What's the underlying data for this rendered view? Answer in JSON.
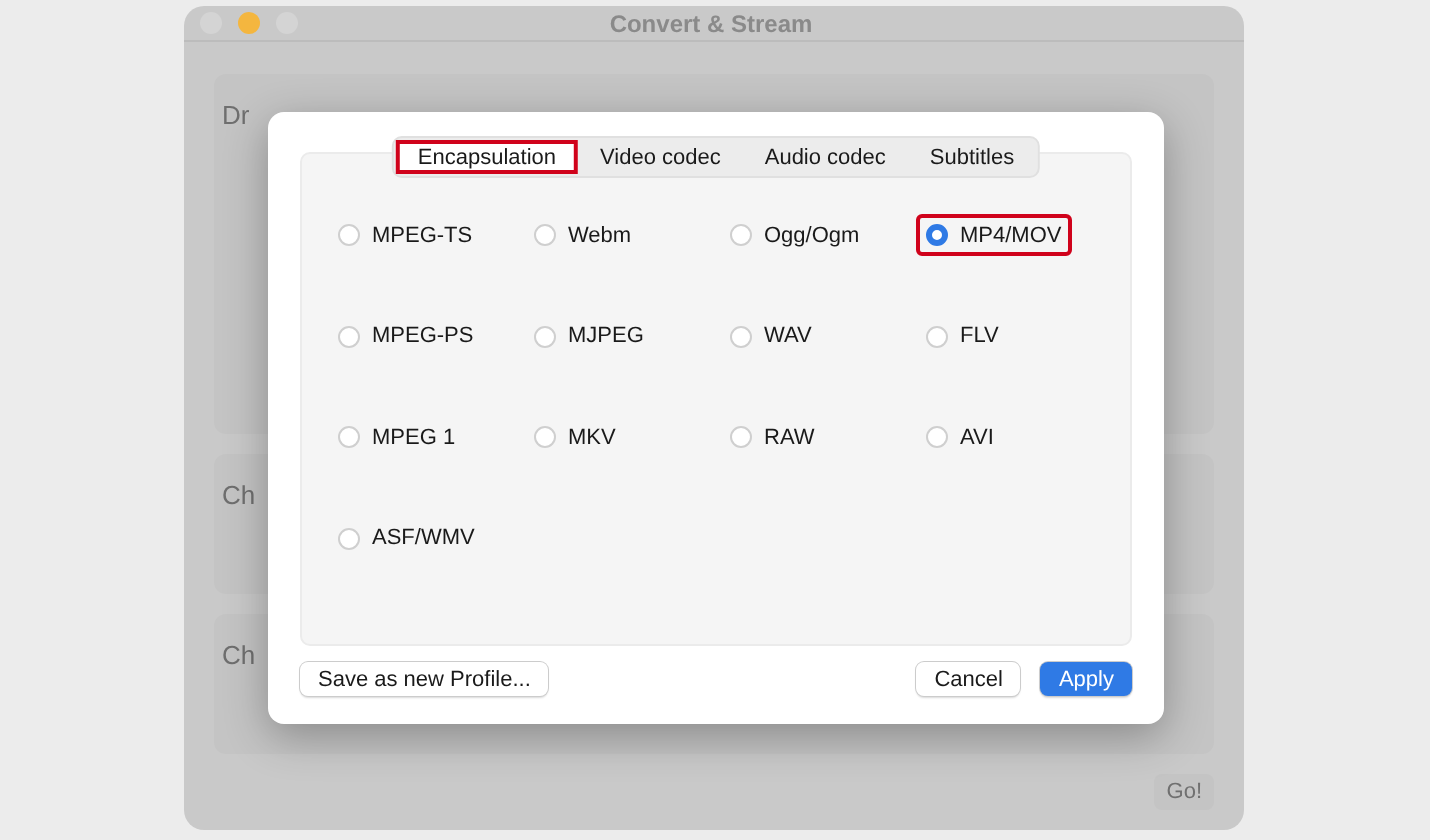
{
  "window": {
    "title": "Convert & Stream",
    "controls": [
      {
        "color": "#d4d4d4"
      },
      {
        "color": "#f4b63f"
      },
      {
        "color": "#d4d4d4"
      }
    ]
  },
  "background": {
    "sections": [
      {
        "heading": "Dr"
      },
      {
        "heading": "Ch"
      },
      {
        "heading": "Ch"
      }
    ],
    "go_button": "Go!"
  },
  "dialog": {
    "tabs": [
      {
        "label": "Encapsulation",
        "selected": true,
        "highlighted": true
      },
      {
        "label": "Video codec",
        "selected": false,
        "highlighted": false
      },
      {
        "label": "Audio codec",
        "selected": false,
        "highlighted": false
      },
      {
        "label": "Subtitles",
        "selected": false,
        "highlighted": false
      }
    ],
    "options": [
      {
        "label": "MPEG-TS",
        "selected": false,
        "highlighted": false
      },
      {
        "label": "Webm",
        "selected": false,
        "highlighted": false
      },
      {
        "label": "Ogg/Ogm",
        "selected": false,
        "highlighted": false
      },
      {
        "label": "MP4/MOV",
        "selected": true,
        "highlighted": true
      },
      {
        "label": "MPEG-PS",
        "selected": false,
        "highlighted": false
      },
      {
        "label": "MJPEG",
        "selected": false,
        "highlighted": false
      },
      {
        "label": "WAV",
        "selected": false,
        "highlighted": false
      },
      {
        "label": "FLV",
        "selected": false,
        "highlighted": false
      },
      {
        "label": "MPEG 1",
        "selected": false,
        "highlighted": false
      },
      {
        "label": "MKV",
        "selected": false,
        "highlighted": false
      },
      {
        "label": "RAW",
        "selected": false,
        "highlighted": false
      },
      {
        "label": "AVI",
        "selected": false,
        "highlighted": false
      },
      {
        "label": "ASF/WMV",
        "selected": false,
        "highlighted": false
      }
    ],
    "save_button": "Save as new Profile...",
    "cancel_button": "Cancel",
    "apply_button": "Apply"
  }
}
